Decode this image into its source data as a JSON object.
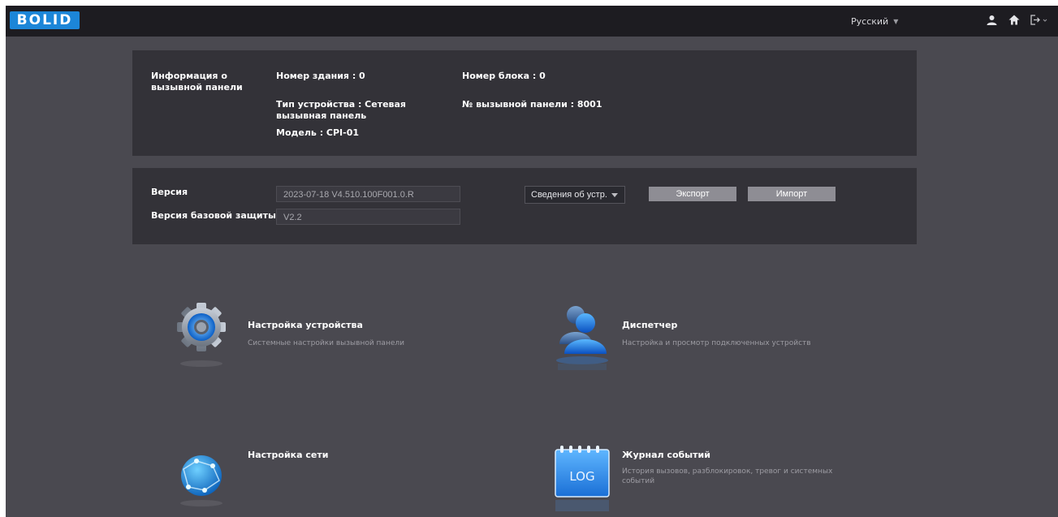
{
  "header": {
    "logo_text": "BOLID",
    "language": "Русский",
    "icons": [
      "user-icon",
      "home-icon",
      "logout-icon"
    ]
  },
  "info": {
    "section_label": "Информация о вызывной панели",
    "building_no": "Номер здания : 0",
    "block_no": "Номер блока : 0",
    "device_type": "Тип устройства : Сетевая вызывная панель",
    "panel_no": "№ вызывной панели : 8001",
    "model": "Модель : CPI-01"
  },
  "version": {
    "version_label": "Версия",
    "version_value": "2023-07-18 V4.510.100F001.0.R",
    "base_protection_label": "Версия базовой защиты",
    "base_protection_value": "V2.2",
    "select_value": "Сведения об устр.",
    "export_label": "Экспорт",
    "import_label": "Импорт"
  },
  "tiles": [
    {
      "title": "Настройка устройства",
      "desc": "Системные настройки вызывной панели",
      "icon": "gear-icon"
    },
    {
      "title": "Диспетчер",
      "desc": "Настройка и просмотр подключенных устройств",
      "icon": "users-icon"
    },
    {
      "title": "Настройка сети",
      "desc": "",
      "icon": "globe-icon"
    },
    {
      "title": "Журнал событий",
      "desc": "История вызовов, разблокировок, тревог и системных событий",
      "icon": "log-icon",
      "icon_text": "LOG"
    }
  ],
  "colors": {
    "topbar": "#1d1c21",
    "background": "#4a4950",
    "panel": "#333238",
    "accent": "#1c86d8"
  }
}
